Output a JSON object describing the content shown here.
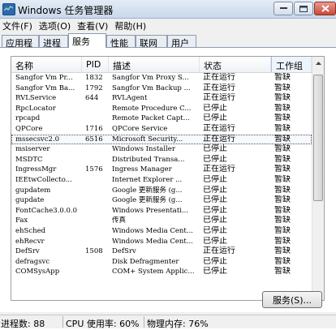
{
  "window": {
    "title": "Windows 任务管理器"
  },
  "menu": [
    "文件(F)",
    "选项(O)",
    "查看(V)",
    "帮助(H)"
  ],
  "tabs": [
    "应用程序",
    "进程",
    "服务",
    "性能",
    "联网",
    "用户"
  ],
  "active_tab": "服务",
  "columns": {
    "name": "名称",
    "pid": "PID",
    "desc": "描述",
    "status": "状态",
    "group": "工作组"
  },
  "services": [
    {
      "name": "Sangfor Vm Pr...",
      "pid": "1832",
      "desc": "Sangfor Vm Proxy S...",
      "status": "正在运行",
      "group": "暂缺"
    },
    {
      "name": "Sangfor Vm Ba...",
      "pid": "1792",
      "desc": "Sangfor Vm Backup ...",
      "status": "正在运行",
      "group": "暂缺"
    },
    {
      "name": "RVLService",
      "pid": "644",
      "desc": "RVLAgent",
      "status": "正在运行",
      "group": "暂缺"
    },
    {
      "name": "RpcLocator",
      "pid": "",
      "desc": "Remote Procedure C...",
      "status": "已停止",
      "group": "暂缺"
    },
    {
      "name": "rpcapd",
      "pid": "",
      "desc": "Remote Packet Capt...",
      "status": "已停止",
      "group": "暂缺"
    },
    {
      "name": "QPCore",
      "pid": "1716",
      "desc": "QPCore Service",
      "status": "正在运行",
      "group": "暂缺"
    },
    {
      "name": "mssecsvc2.0",
      "pid": "6516",
      "desc": "Microsoft Security...",
      "status": "正在运行",
      "group": "暂缺",
      "selected": true
    },
    {
      "name": "msiserver",
      "pid": "",
      "desc": "Windows Installer",
      "status": "已停止",
      "group": "暂缺"
    },
    {
      "name": "MSDTC",
      "pid": "",
      "desc": "Distributed Transa...",
      "status": "已停止",
      "group": "暂缺"
    },
    {
      "name": "IngressMgr",
      "pid": "1576",
      "desc": "Ingress Manager",
      "status": "正在运行",
      "group": "暂缺"
    },
    {
      "name": "IEEtwCollecto...",
      "pid": "",
      "desc": "Internet Explorer ...",
      "status": "已停止",
      "group": "暂缺"
    },
    {
      "name": "gupdatem",
      "pid": "",
      "desc": "Google 更新服务 (g...",
      "status": "已停止",
      "group": "暂缺"
    },
    {
      "name": "gupdate",
      "pid": "",
      "desc": "Google 更新服务 (g...",
      "status": "已停止",
      "group": "暂缺"
    },
    {
      "name": "FontCache3.0.0.0",
      "pid": "",
      "desc": "Windows Presentati...",
      "status": "已停止",
      "group": "暂缺"
    },
    {
      "name": "Fax",
      "pid": "",
      "desc": "传真",
      "status": "已停止",
      "group": "暂缺"
    },
    {
      "name": "ehSched",
      "pid": "",
      "desc": "Windows Media Cent...",
      "status": "已停止",
      "group": "暂缺"
    },
    {
      "name": "ehRecvr",
      "pid": "",
      "desc": "Windows Media Cent...",
      "status": "已停止",
      "group": "暂缺"
    },
    {
      "name": "DefSrv",
      "pid": "1508",
      "desc": "DefSrv",
      "status": "正在运行",
      "group": "暂缺"
    },
    {
      "name": "defragsvc",
      "pid": "",
      "desc": "Disk Defragmenter",
      "status": "已停止",
      "group": "暂缺"
    },
    {
      "name": "COMSysApp",
      "pid": "",
      "desc": "COM+ System Applic...",
      "status": "已停止",
      "group": "暂缺"
    }
  ],
  "services_button": "服务(S)...",
  "statusbar": {
    "processes": "进程数: 88",
    "cpu": "CPU 使用率: 60%",
    "memory": "物理内存: 76%"
  },
  "colors": {
    "selection_outline": "#555555",
    "titlebar": "#c9d8ea",
    "close_button": "#c94a36"
  }
}
